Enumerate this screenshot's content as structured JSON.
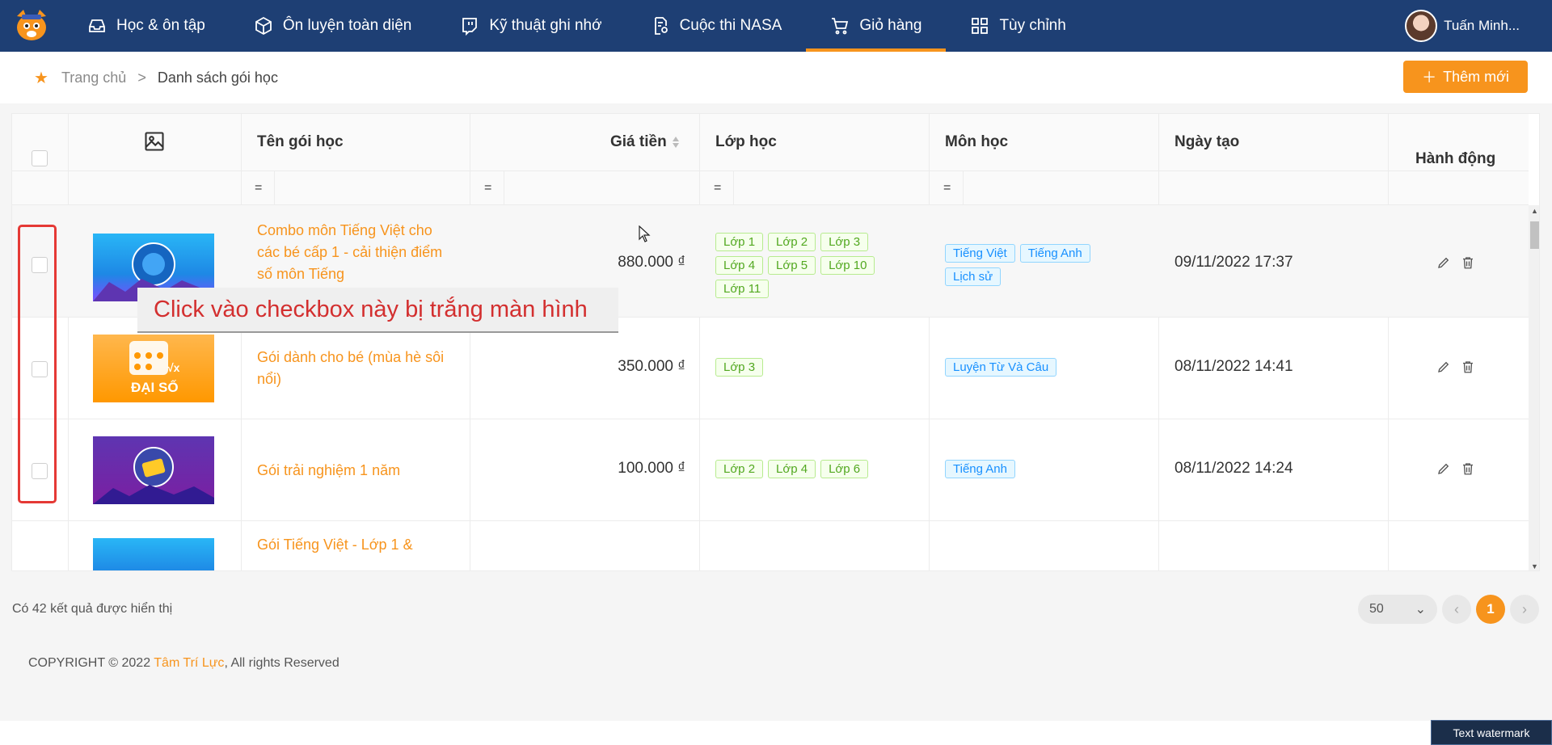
{
  "nav": {
    "items": [
      {
        "label": "Học & ôn tập",
        "icon": "inbox-icon"
      },
      {
        "label": "Ôn luyện toàn diện",
        "icon": "cube-icon"
      },
      {
        "label": "Kỹ thuật ghi nhớ",
        "icon": "twitch-icon"
      },
      {
        "label": "Cuộc thi NASA",
        "icon": "file-badge-icon"
      },
      {
        "label": "Giỏ hàng",
        "icon": "cart-icon",
        "active": true
      },
      {
        "label": "Tùy chỉnh",
        "icon": "grid-icon"
      }
    ],
    "user_name": "Tuấn Minh..."
  },
  "breadcrumb": {
    "home": "Trang chủ",
    "separator": ">",
    "current": "Danh sách gói học"
  },
  "add_button": "Thêm mới",
  "table": {
    "headers": {
      "name": "Tên gói học",
      "price": "Giá tiền",
      "grade": "Lớp học",
      "subject": "Môn học",
      "created": "Ngày tạo",
      "actions": "Hành động"
    },
    "filter_eq": "=",
    "rows": [
      {
        "name": "Combo môn Tiếng Việt cho các bé cấp 1 - cải thiện điểm số môn Tiếng",
        "price": "880.000 ₫",
        "grades": [
          "Lớp 1",
          "Lớp 2",
          "Lớp 3",
          "Lớp 4",
          "Lớp 5",
          "Lớp 10",
          "Lớp 11"
        ],
        "subjects": [
          "Tiếng Việt",
          "Tiếng Anh",
          "Lịch sử"
        ],
        "date": "09/11/2022 17:37"
      },
      {
        "name": "Gói dành cho bé (mùa hè sôi nổi)",
        "price": "350.000 ₫",
        "grades": [
          "Lớp 3"
        ],
        "subjects": [
          "Luyện Từ Và Câu"
        ],
        "date": "08/11/2022 14:41"
      },
      {
        "name": "Gói trải nghiệm 1 năm",
        "price": "100.000 ₫",
        "grades": [
          "Lớp 2",
          "Lớp 4",
          "Lớp 6"
        ],
        "subjects": [
          "Tiếng Anh"
        ],
        "date": "08/11/2022 14:24"
      },
      {
        "name": "Gói Tiếng Việt - Lớp 1 &",
        "price": "",
        "grades": [],
        "subjects": [],
        "date": ""
      }
    ]
  },
  "thumbs": {
    "row2_text": "ĐẠI SỐ"
  },
  "annotation": "Click vào checkbox này bị trắng màn hình",
  "result_text": "Có 42 kết quả được hiển thị",
  "pagination": {
    "page_size": "50",
    "current": "1"
  },
  "copyright": {
    "prefix": "COPYRIGHT © 2022 ",
    "brand": "Tâm Trí Lực",
    "suffix": ", All rights Reserved"
  },
  "watermark": "Text watermark",
  "colors": {
    "nav": "#1e3f74",
    "accent": "#f7941d",
    "tag_green": "#52a820",
    "tag_blue": "#1890ff",
    "annotation_red": "#e53935"
  }
}
